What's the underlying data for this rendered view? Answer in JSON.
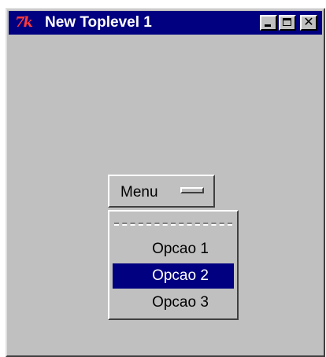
{
  "window": {
    "title": "New Toplevel 1",
    "app_icon": "tk-feather-logo",
    "app_icon_text": "7k"
  },
  "titlebar_buttons": {
    "minimize_icon": "minimize-icon",
    "maximize_icon": "maximize-icon",
    "close_icon": "close-icon",
    "close_glyph": "✕"
  },
  "menubutton": {
    "label": "Menu",
    "indicator_icon": "menubutton-indicator-icon"
  },
  "dropdown": {
    "items": [
      {
        "label": "Opcao 1",
        "highlighted": false
      },
      {
        "label": "Opcao 2",
        "highlighted": true
      },
      {
        "label": "Opcao 3",
        "highlighted": false
      }
    ]
  },
  "colors": {
    "titlebar": "#000080",
    "face": "#c0c0c0",
    "highlight": "#000080"
  }
}
